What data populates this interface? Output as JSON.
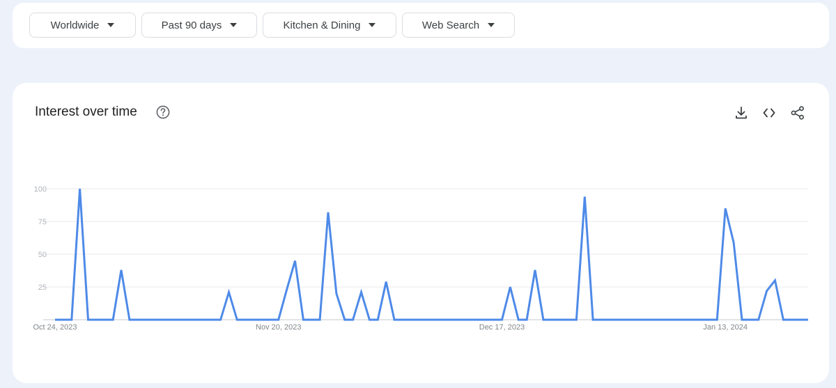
{
  "filters": [
    {
      "label": "Worldwide"
    },
    {
      "label": "Past 90 days"
    },
    {
      "label": "Kitchen & Dining"
    },
    {
      "label": "Web Search"
    }
  ],
  "card": {
    "title": "Interest over time"
  },
  "icons": {
    "help": "help-circle-icon",
    "download": "download-icon",
    "embed": "code-embed-icon",
    "share": "share-icon"
  },
  "colors": {
    "line": "#4e8ae8",
    "grid": "#e8eaed",
    "axis": "#9aa0a6"
  },
  "chart_data": {
    "type": "line",
    "ylim": [
      0,
      100
    ],
    "yticks": [
      0,
      25,
      50,
      75,
      100
    ],
    "ytick_labels": [
      "",
      "25",
      "50",
      "75",
      "100"
    ],
    "xtick_labels": [
      "Oct 24, 2023",
      "Nov 20, 2023",
      "Dec 17, 2023",
      "Jan 13, 2024"
    ],
    "xtick_index": [
      0,
      27,
      54,
      81
    ],
    "values": [
      0,
      0,
      0,
      100,
      0,
      0,
      0,
      0,
      38,
      0,
      0,
      0,
      0,
      0,
      0,
      0,
      0,
      0,
      0,
      0,
      0,
      21,
      0,
      0,
      0,
      0,
      0,
      0,
      23,
      45,
      0,
      0,
      0,
      82,
      20,
      0,
      0,
      21,
      0,
      0,
      29,
      0,
      0,
      0,
      0,
      0,
      0,
      0,
      0,
      0,
      0,
      0,
      0,
      0,
      0,
      25,
      0,
      0,
      38,
      0,
      0,
      0,
      0,
      0,
      94,
      0,
      0,
      0,
      0,
      0,
      0,
      0,
      0,
      0,
      0,
      0,
      0,
      0,
      0,
      0,
      0,
      85,
      59,
      0,
      0,
      0,
      22,
      30,
      0,
      0,
      0,
      0
    ]
  }
}
